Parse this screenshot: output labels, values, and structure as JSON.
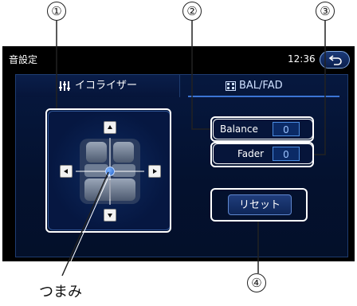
{
  "callouts": [
    "①",
    "②",
    "③",
    "④"
  ],
  "screen": {
    "title": "音設定",
    "time": "12:36",
    "tabs": {
      "eq_label": "イコライザー",
      "bal_fad_label": "BAL/FAD"
    },
    "balance": {
      "label": "Balance",
      "value": "0"
    },
    "fader": {
      "label": "Fader",
      "value": "0"
    },
    "reset_label": "リセット"
  },
  "knob_caption": "つまみ",
  "colors": {
    "screen_bg": "#000000",
    "panel": "#061741",
    "accent": "#3b74d4",
    "value_text": "#9cc3ff"
  }
}
